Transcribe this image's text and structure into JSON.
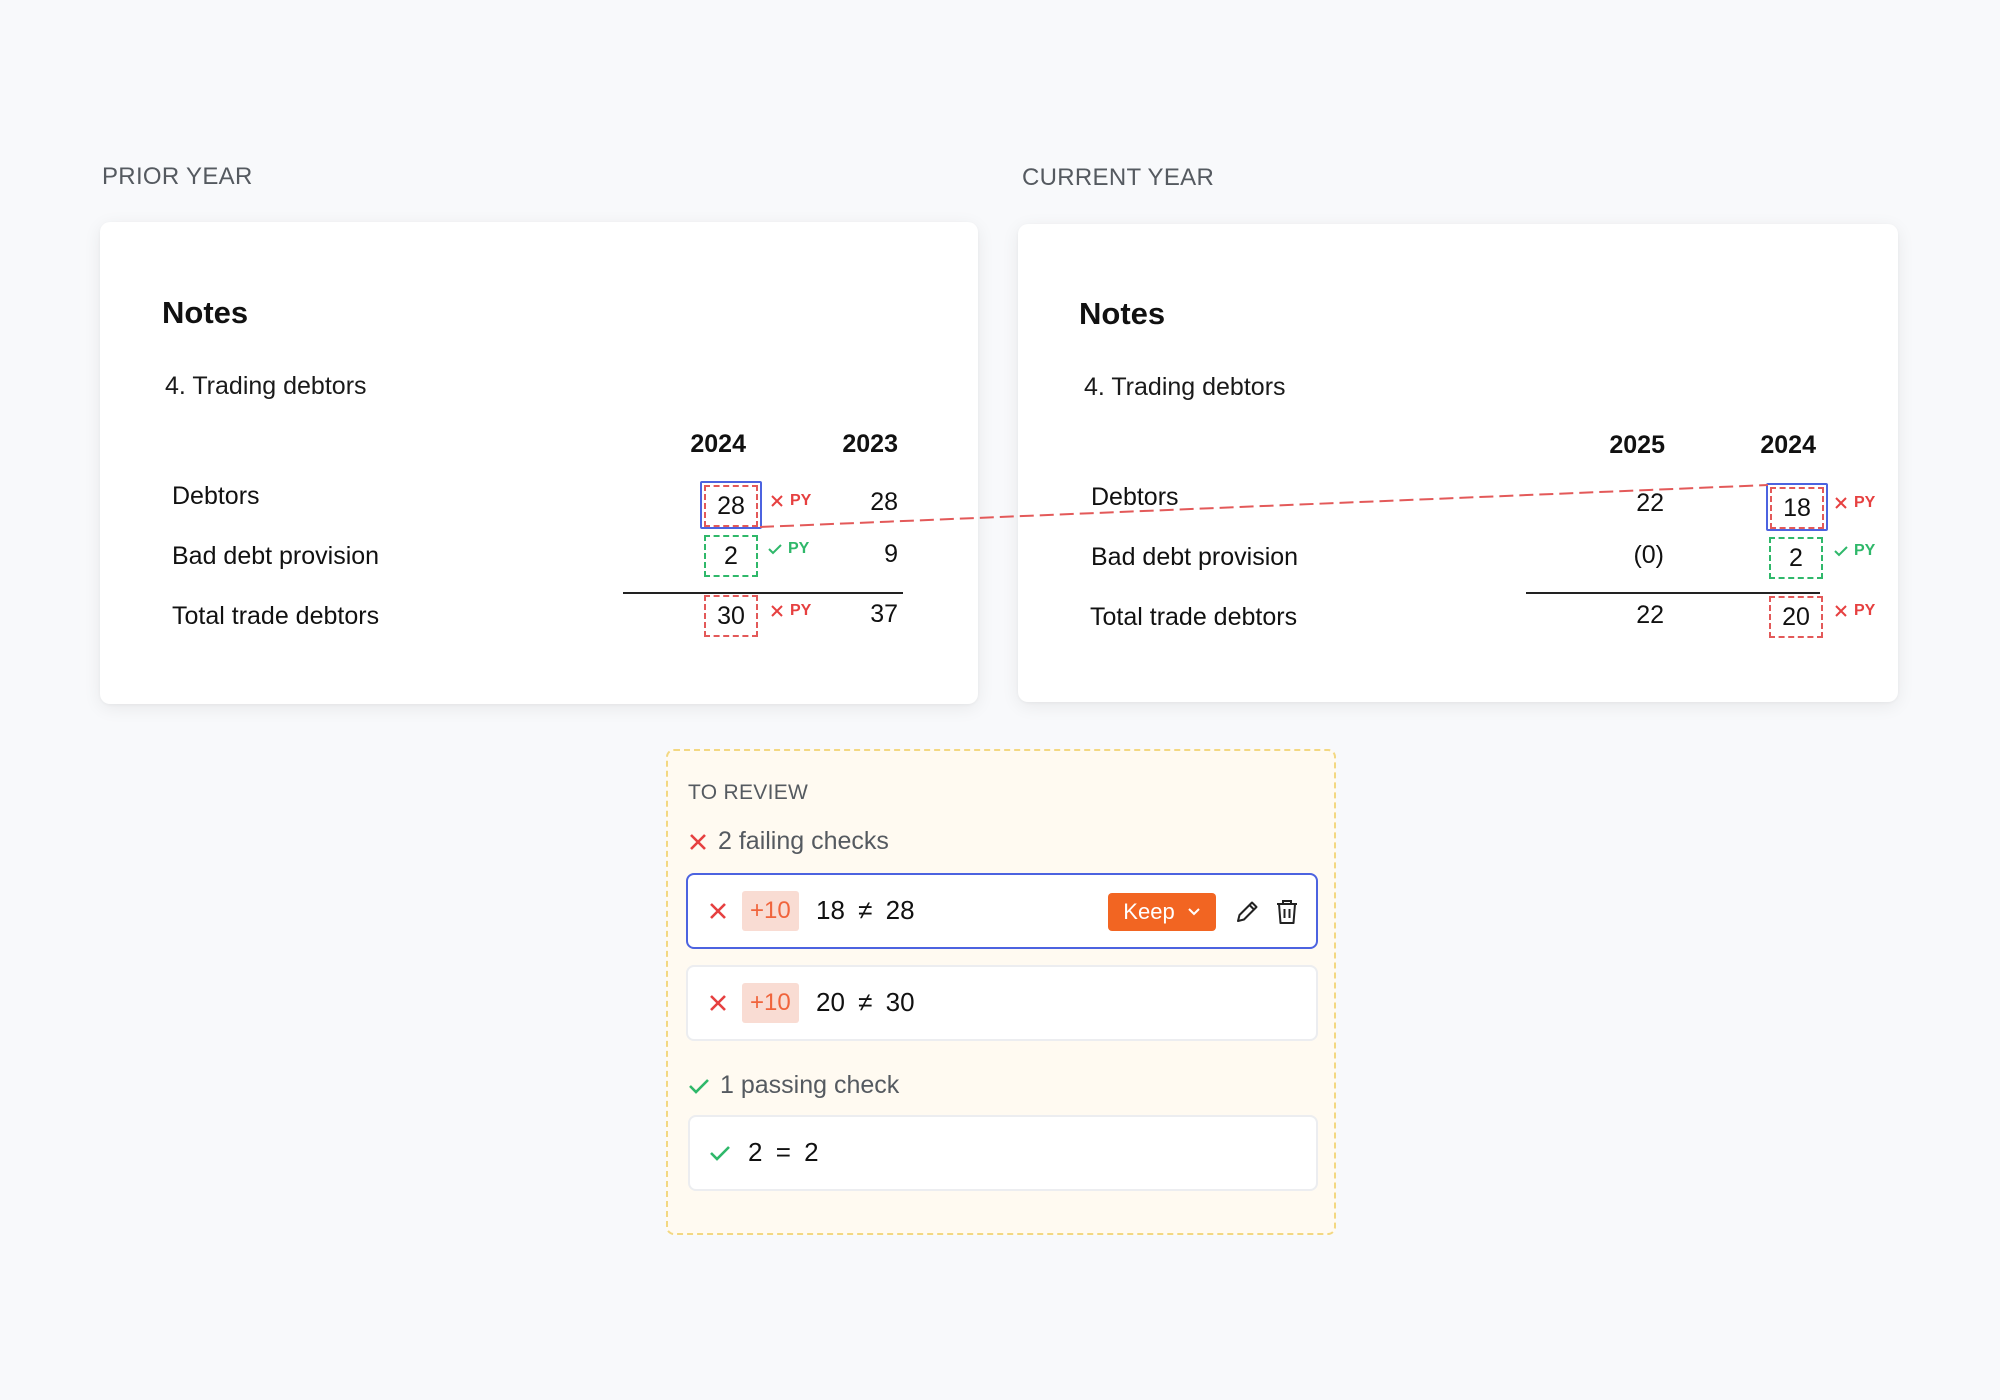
{
  "prior": {
    "section_label": "PRIOR YEAR",
    "notes_title": "Notes",
    "note_heading": "4. Trading debtors",
    "col_headers": [
      "2024",
      "2023"
    ],
    "rows": [
      {
        "label": "Debtors",
        "values": [
          "28",
          "28"
        ],
        "flag": "PY",
        "flag_status": "fail"
      },
      {
        "label": "Bad debt provision",
        "values": [
          "2",
          "9"
        ],
        "flag": "PY",
        "flag_status": "pass"
      },
      {
        "label": "Total trade debtors",
        "values": [
          "30",
          "37"
        ],
        "flag": "PY",
        "flag_status": "fail"
      }
    ]
  },
  "current": {
    "section_label": "CURRENT YEAR",
    "notes_title": "Notes",
    "note_heading": "4. Trading debtors",
    "col_headers": [
      "2025",
      "2024"
    ],
    "rows": [
      {
        "label": "Debtors",
        "values": [
          "22",
          "18"
        ],
        "flag": "PY",
        "flag_status": "fail"
      },
      {
        "label": "Bad debt provision",
        "values": [
          "(0)",
          "2"
        ],
        "flag": "PY",
        "flag_status": "pass"
      },
      {
        "label": "Total trade debtors",
        "values": [
          "22",
          "20"
        ],
        "flag": "PY",
        "flag_status": "fail"
      }
    ]
  },
  "review": {
    "title": "TO REVIEW",
    "failing_header": "2 failing checks",
    "passing_header": "1 passing check",
    "failing": [
      {
        "badge": "+10",
        "left": "18",
        "op": "≠",
        "right": "28",
        "active": true
      },
      {
        "badge": "+10",
        "left": "20",
        "op": "≠",
        "right": "30",
        "active": false
      }
    ],
    "passing": [
      {
        "left": "2",
        "op": "=",
        "right": "2"
      }
    ],
    "keep_label": "Keep"
  },
  "colors": {
    "fail": "#e64040",
    "pass": "#2fb86a",
    "accent": "#f26522",
    "selection": "#4c63e0"
  },
  "icons": {
    "fail": "x-icon",
    "pass": "check-icon",
    "edit": "pencil-icon",
    "delete": "trash-icon",
    "dropdown": "chevron-down-icon"
  }
}
